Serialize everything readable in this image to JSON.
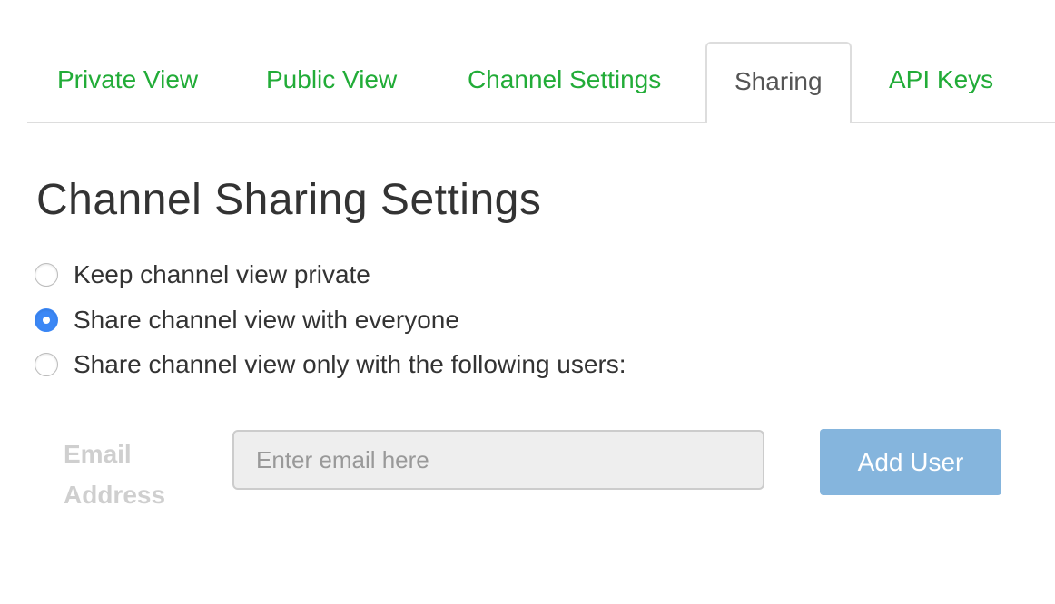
{
  "tabs": [
    {
      "label": "Private View",
      "active": false
    },
    {
      "label": "Public View",
      "active": false
    },
    {
      "label": "Channel Settings",
      "active": false
    },
    {
      "label": "Sharing",
      "active": true
    },
    {
      "label": "API Keys",
      "active": false
    }
  ],
  "heading": "Channel Sharing Settings",
  "options": [
    {
      "label": "Keep channel view private",
      "selected": false
    },
    {
      "label": "Share channel view with everyone",
      "selected": true
    },
    {
      "label": "Share channel view only with the following users:",
      "selected": false
    }
  ],
  "email": {
    "label": "Email Address",
    "placeholder": "Enter email here",
    "value": ""
  },
  "add_button": "Add User",
  "colors": {
    "tab_link": "#22ac38",
    "radio_selected": "#3b87f5",
    "button": "#85b5dd"
  }
}
